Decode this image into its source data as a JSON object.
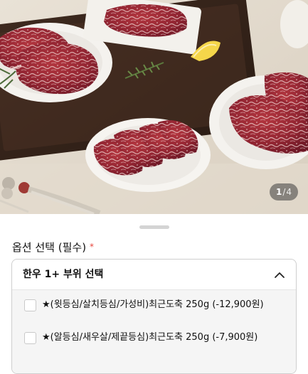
{
  "gallery": {
    "current_page": "1",
    "separator": "/",
    "total_pages": "4"
  },
  "options_sheet": {
    "title": "옵션 선택 (필수)",
    "required_mark": "*",
    "dropdown": {
      "label": "한우 1+ 부위 선택",
      "expanded": true,
      "items": [
        {
          "label": "★(윗등심/살치등심/가성비)최근도축 250g (-12,900원)",
          "checked": false
        },
        {
          "label": "★(알등심/새우살/제끝등심)최근도축 250g (-7,900원)",
          "checked": false
        }
      ]
    }
  },
  "colors": {
    "required_accent": "#e8453c",
    "border": "#cfcfcf",
    "option_background": "#f5f5f5"
  },
  "icons": {
    "dropdown_toggle": "chevron-up-icon"
  }
}
